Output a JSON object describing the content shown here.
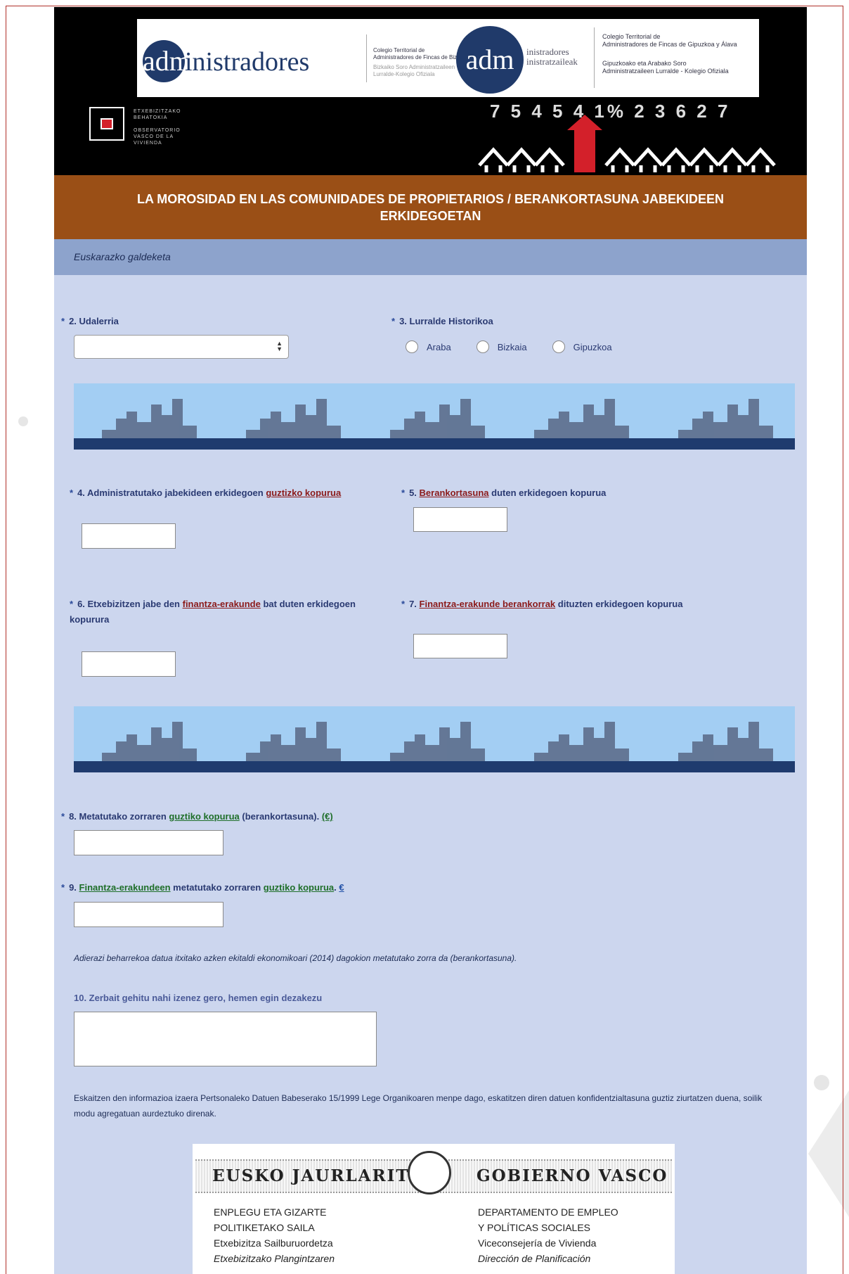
{
  "header": {
    "logo_left_main": "administradores",
    "logo_left_sub1": "Colegio Territorial de\nAdministradores de Fincas de Bizkaia",
    "logo_left_sub2": "Bizkaiko Soro Administratzaileen\nLurralde-Kolegio Ofiziala",
    "logo_right_main": "adm",
    "logo_right_rest": "inistradores\ninistratzaileak",
    "logo_right_sub1": "Colegio Territorial de\nAdministradores de Fincas de Gipuzkoa y Álava",
    "logo_right_sub2": "Gipuzkoako eta Arabako Soro\nAdministratzaileen Lurralde - Kolegio Ofiziala",
    "obs_text": "ETXEBIZITZAKO\nBEHATOKIA\n\nOBSERVATORIO\nVASCO DE LA\nVIVIENDA",
    "numbers_art": "7 5 4 5 4 1% 2 3 6 2 7"
  },
  "title": "LA MOROSIDAD EN LAS COMUNIDADES DE PROPIETARIOS / BERANKORTASUNA JABEKIDEEN ERKIDEGOETAN",
  "subheader": "Euskarazko galdeketa",
  "q2": {
    "label": "2. Udalerria",
    "value": ""
  },
  "q3": {
    "label": "3. Lurralde Historikoa",
    "options": [
      "Araba",
      "Bizkaia",
      "Gipuzkoa"
    ]
  },
  "q4": {
    "label_a": "4. Administratutako jabekideen erkidegoen ",
    "link": "guztizko kopurua",
    "value": ""
  },
  "q5": {
    "label_a": "5. ",
    "link": "Berankortasuna",
    "label_b": " duten erkidegoen kopurua",
    "value": ""
  },
  "q6": {
    "label_a": "6. Etxebizitzen jabe den ",
    "link": "finantza-erakunde",
    "label_b": " bat duten erkidegoen kopurura",
    "value": ""
  },
  "q7": {
    "label_a": "7. ",
    "link": "Finantza-erakunde berankorrak",
    "label_b": " dituzten erkidegoen kopurua",
    "value": ""
  },
  "q8": {
    "label_a": "8. Metatutako zorraren ",
    "link": "guztiko kopurua",
    "label_b": " (berankortasuna). ",
    "link2": "(€)",
    "value": ""
  },
  "q9": {
    "link": "Finantza-erakundeen",
    "label_b": " metatutako zorraren ",
    "link2": "guztiko kopurua",
    "label_c": ". ",
    "link3": "€",
    "label_a": "9. ",
    "value": ""
  },
  "note": "Adierazi beharrekoa datua itxitako azken ekitaldi ekonomikoari (2014) dagokion metatutako zorra da (berankortasuna).",
  "q10": {
    "label": "10. Zerbait gehitu nahi izenez gero, hemen egin dezakezu",
    "value": ""
  },
  "legal": "Eskaitzen den informazioa izaera Pertsonaleko Datuen Babeserako 15/1999 Lege Organikoaren menpe dago, eskatitzen diren datuen konfidentzialtasuna guztiz ziurtatzen duena, soilik modu agregatuan aurdeztuko direnak.",
  "gov": {
    "left_title": "EUSKO JAURLARITZA",
    "right_title": "GOBIERNO VASCO",
    "left_l1": "ENPLEGU ETA GIZARTE",
    "left_l2": "POLITIKETAKO SAILA",
    "left_l3": "Etxebizitza Sailburuordetza",
    "left_l4": "Etxebizitzako Plangintzaren",
    "right_l1": "DEPARTAMENTO DE EMPLEO",
    "right_l2": "Y POLÍTICAS SOCIALES",
    "right_l3": "Viceconsejería de Vivienda",
    "right_l4": "Dirección de Planificación"
  },
  "colors": {
    "title_bar": "#9a4f16",
    "page_bg": "#ccd6ee",
    "subheader": "#8da3cc",
    "header": "#000000"
  }
}
